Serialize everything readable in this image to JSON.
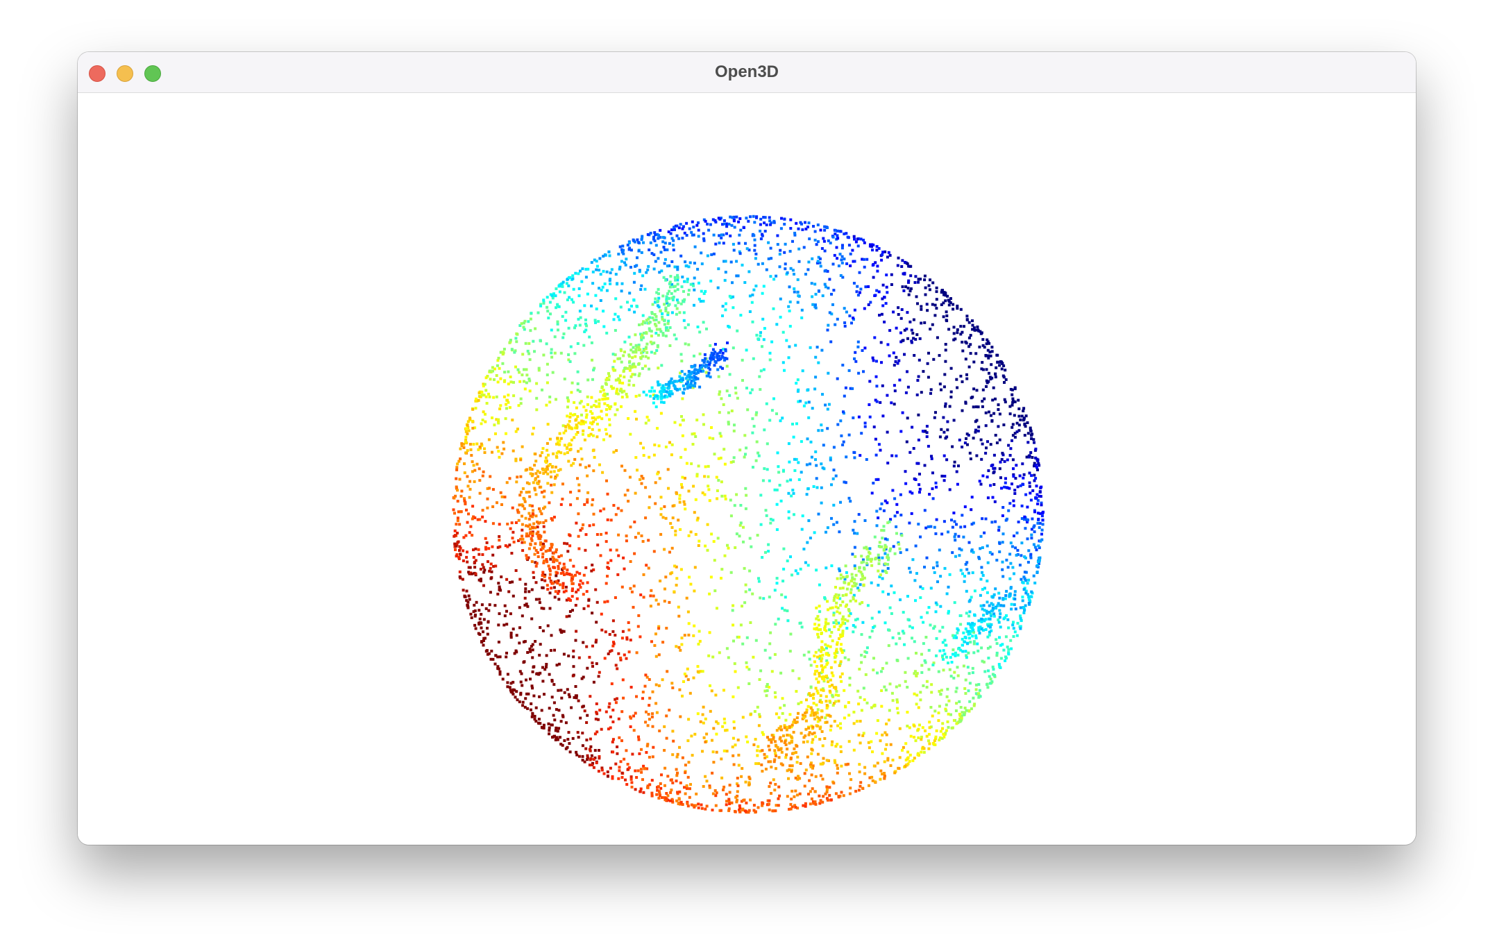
{
  "window": {
    "title": "Open3D",
    "controls": {
      "close": "close-button",
      "minimize": "minimize-button",
      "zoom": "zoom-button"
    }
  },
  "viewport": {
    "background": "#ffffff",
    "content": "point-cloud-sphere",
    "colormap": [
      "#7f0000",
      "#ff2a00",
      "#ff8c00",
      "#ffff00",
      "#7fff7f",
      "#00ffff",
      "#0080ff",
      "#0000ff",
      "#00007f"
    ]
  }
}
